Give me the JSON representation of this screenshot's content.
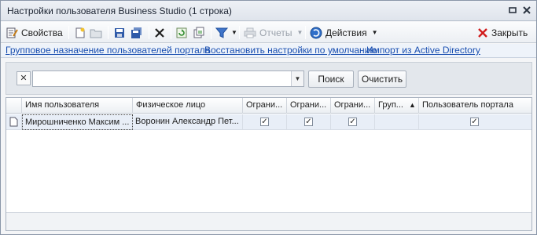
{
  "window": {
    "title": "Настройки пользователя Business Studio (1 строка)",
    "pin_icon": "pin-icon",
    "close_icon": "close-window-icon"
  },
  "toolbar": {
    "properties_label": "Свойства",
    "reports_label": "Отчеты",
    "actions_label": "Действия",
    "close_label": "Закрыть"
  },
  "links": {
    "group_assign": "Групповое назначение пользователей портала",
    "restore_defaults": "Восстановить настройки по умолчанию",
    "import_ad": "Импорт из Active Directory"
  },
  "filter": {
    "search_value": "",
    "search_button": "Поиск",
    "clear_button": "Очистить"
  },
  "grid": {
    "columns": [
      "Имя пользователя",
      "Физическое лицо",
      "Ограни...",
      "Ограни...",
      "Ограни...",
      "Груп...",
      "Пользователь портала"
    ],
    "rows": [
      {
        "user_name": "Мирошниченко Максим ...",
        "person": "Воронин Александр Пет...",
        "restrict1": true,
        "restrict2": true,
        "restrict3": true,
        "group": "",
        "portal_user": true
      }
    ]
  },
  "colors": {
    "link": "#1a4fb0",
    "close_x": "#d11b1b",
    "selected_row": "#e8eef7"
  }
}
